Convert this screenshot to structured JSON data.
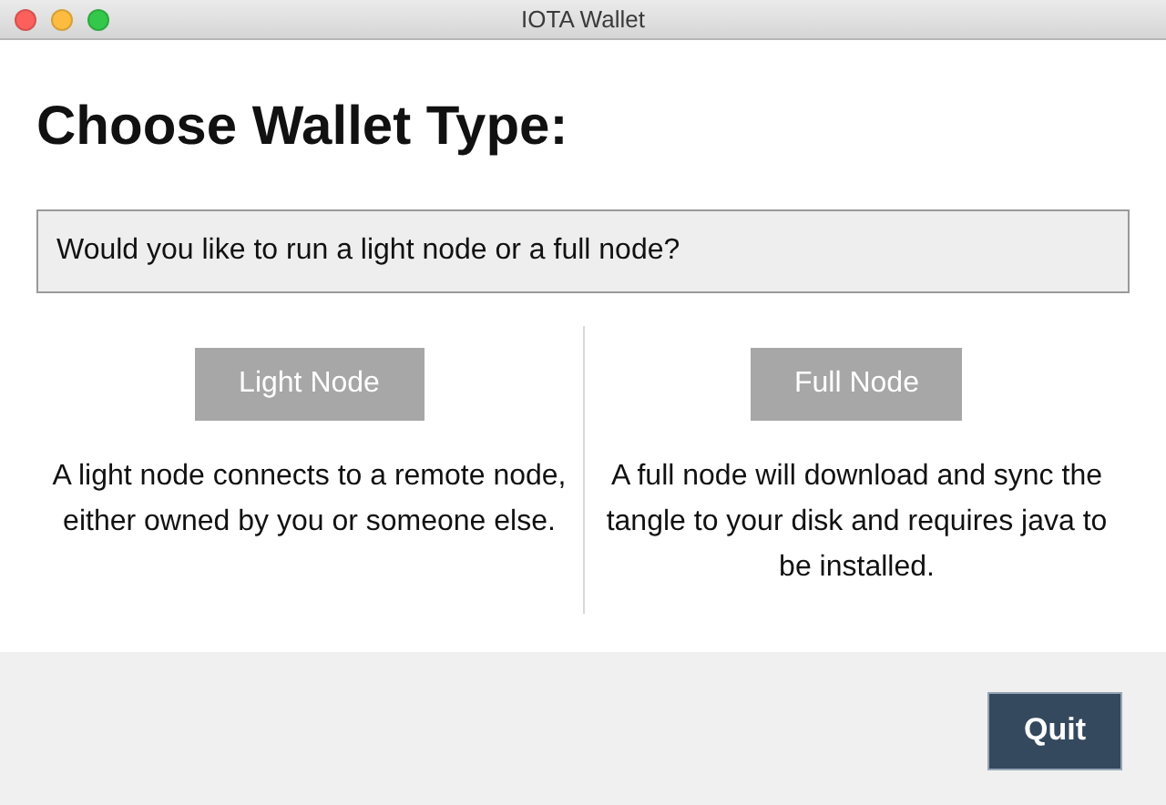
{
  "window": {
    "title": "IOTA Wallet"
  },
  "heading": "Choose Wallet Type:",
  "question": "Would you like to run a light node or a full node?",
  "options": [
    {
      "label": "Light Node",
      "description": "A light node connects to a remote node, either owned by you or someone else."
    },
    {
      "label": "Full Node",
      "description": "A full node will download and sync the tangle to your disk and requires java to be installed."
    }
  ],
  "footer": {
    "button": "Quit"
  }
}
